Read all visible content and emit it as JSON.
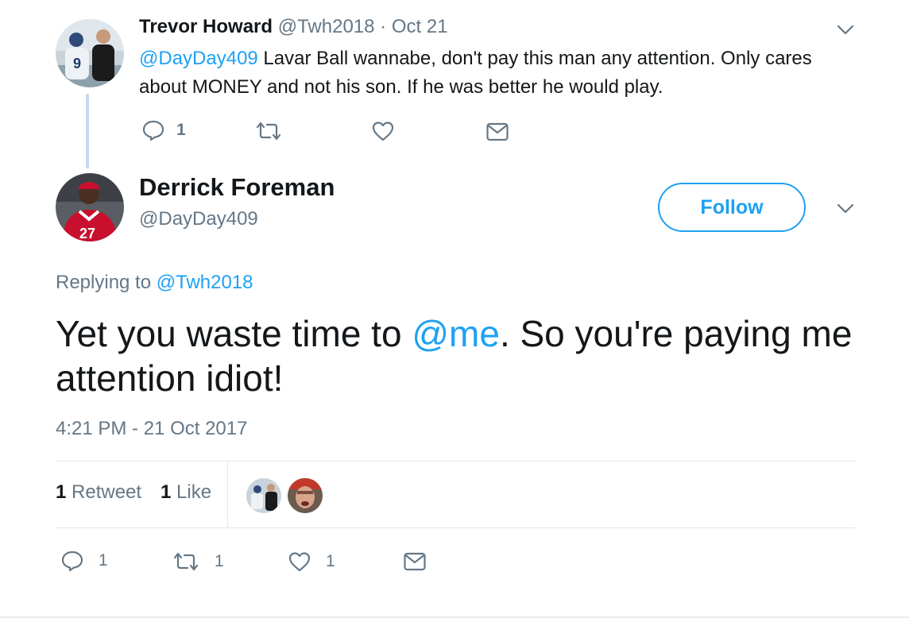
{
  "parent_tweet": {
    "name": "Trevor Howard",
    "handle": "@Twh2018",
    "separator": "·",
    "date": "Oct 21",
    "mention": "@DayDay409",
    "text": " Lavar Ball wannabe, don't pay this man any attention. Only cares about MONEY and not his son. If he was better he would play.",
    "reply_count": "1",
    "retweet_count": "",
    "like_count": ""
  },
  "main_tweet": {
    "name": "Derrick Foreman",
    "handle": "@DayDay409",
    "follow_label": "Follow",
    "replying_prefix": "Replying to ",
    "replying_to": "@Twh2018",
    "text_before": "Yet you waste time to ",
    "text_mention": "@me",
    "text_after": ". So you're paying me attention idiot!",
    "timestamp": "4:21 PM - 21 Oct 2017",
    "stats": {
      "retweets_count": "1",
      "retweets_label": "Retweet",
      "likes_count": "1",
      "likes_label": "Like"
    },
    "actions": {
      "reply_count": "1",
      "retweet_count": "1",
      "like_count": "1"
    }
  },
  "icons": {
    "reply": "reply-icon",
    "retweet": "retweet-icon",
    "like": "heart-icon",
    "dm": "envelope-icon",
    "menu": "chevron-down-icon"
  },
  "colors": {
    "accent": "#1da1f2",
    "text": "#14171a",
    "muted": "#657786",
    "thread_line": "#c4d9ec"
  }
}
